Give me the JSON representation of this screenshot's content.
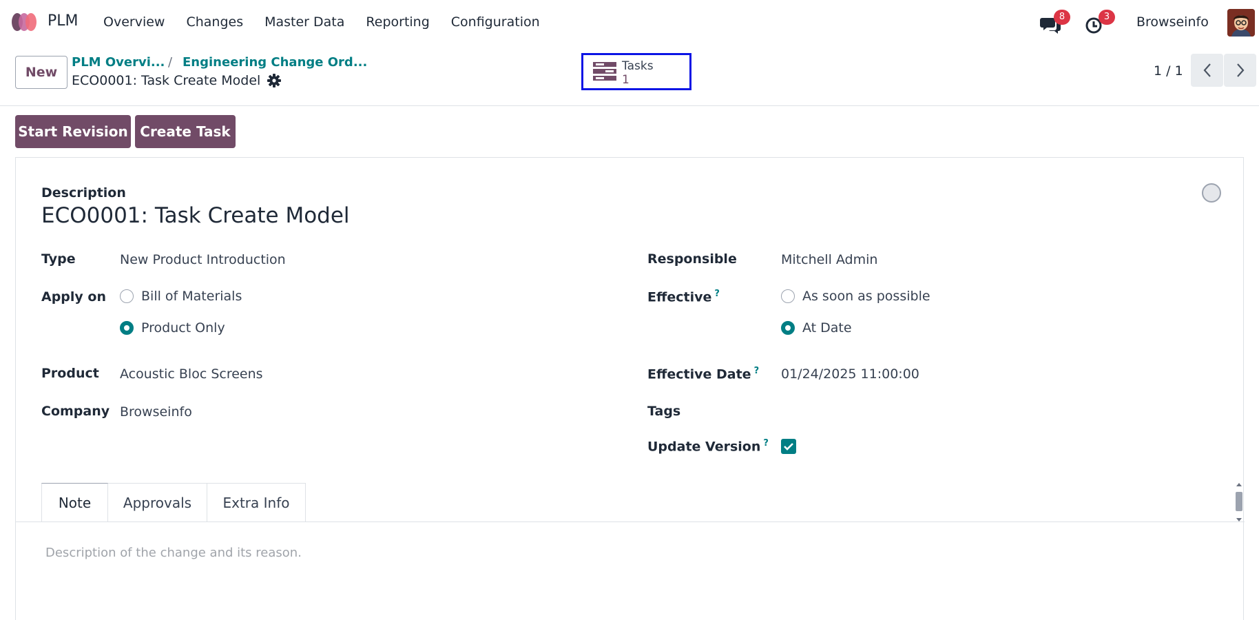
{
  "navbar": {
    "app_name": "PLM",
    "menu": [
      "Overview",
      "Changes",
      "Master Data",
      "Reporting",
      "Configuration"
    ],
    "messages_count": "8",
    "activities_count": "3",
    "user_name": "Browseinfo"
  },
  "control_panel": {
    "new_label": "New",
    "breadcrumb": [
      "PLM Overvi...",
      "Engineering Change Ord..."
    ],
    "breadcrumb_sep": "/",
    "current_record": "ECO0001: Task Create Model",
    "smart_button": {
      "label": "Tasks",
      "value": "1"
    },
    "pager": "1 / 1"
  },
  "actions": {
    "start_revision": "Start Revision",
    "create_task": "Create Task"
  },
  "form": {
    "description_label": "Description",
    "title": "ECO0001: Task Create Model",
    "type_label": "Type",
    "type_value": "New Product Introduction",
    "apply_on_label": "Apply on",
    "apply_on_options": [
      "Bill of Materials",
      "Product Only"
    ],
    "apply_on_selected": "Product Only",
    "product_label": "Product",
    "product_value": "Acoustic Bloc Screens",
    "company_label": "Company",
    "company_value": "Browseinfo",
    "responsible_label": "Responsible",
    "responsible_value": "Mitchell Admin",
    "effective_label": "Effective",
    "effective_options": [
      "As soon as possible",
      "At Date"
    ],
    "effective_selected": "At Date",
    "effective_date_label": "Effective Date",
    "effective_date_value": "01/24/2025 11:00:00",
    "tags_label": "Tags",
    "update_version_label": "Update Version",
    "update_version_checked": true,
    "help_mark": "?"
  },
  "tabs": [
    "Note",
    "Approvals",
    "Extra Info"
  ],
  "note_placeholder": "Description of the change and its reason.",
  "colors": {
    "brand": "#714B67",
    "accent": "#017e84",
    "highlight": "#0b14e5",
    "badge": "#dc3545"
  }
}
